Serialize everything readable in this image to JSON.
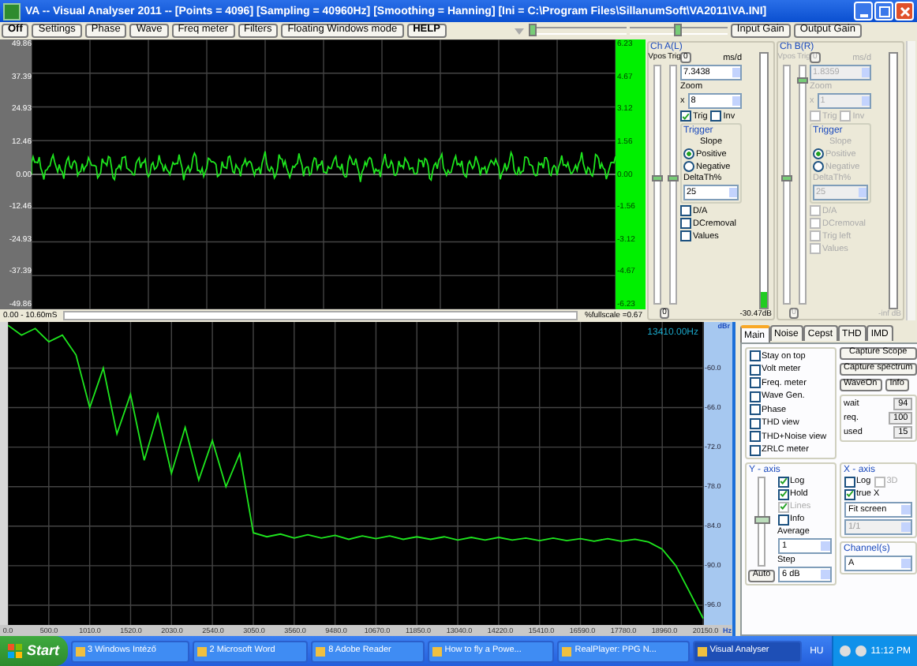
{
  "window": {
    "title": "VA  -- Visual Analyser 2011 --  [Points = 4096]  [Sampling = 40960Hz]  [Smoothing = Hanning]  [Ini = C:\\Program Files\\SillanumSoft\\VA2011\\VA.INI]"
  },
  "toolbar": {
    "buttons": [
      {
        "label": "Off",
        "bold": true
      },
      {
        "label": "Settings",
        "bold": false
      },
      {
        "label": "Phase",
        "bold": false
      },
      {
        "label": "Wave",
        "bold": false
      },
      {
        "label": "Freq meter",
        "bold": false
      },
      {
        "label": "Filters",
        "bold": false
      },
      {
        "label": "Floating Windows mode",
        "bold": false
      },
      {
        "label": "HELP",
        "bold": true
      }
    ],
    "sliders": [
      {
        "level": 0.0
      },
      {
        "level": 0.5
      }
    ],
    "gain_buttons": [
      "Input Gain",
      "Output Gain"
    ]
  },
  "scope": {
    "left_ticks": [
      "49.86",
      "37.39",
      "24.93",
      "12.46",
      "0.00",
      "-12.46",
      "-24.93",
      "-37.39",
      "-49.86"
    ],
    "right_ticks": [
      "6.23",
      "4.67",
      "3.12",
      "1.56",
      "0.00",
      "-1.56",
      "-3.12",
      "-4.67",
      "-6.23"
    ],
    "time_range": "0.00 - 10.60mS",
    "fullscale": "%fullscale =0.67"
  },
  "channels": [
    {
      "title": "Ch A(L)",
      "disabled": false,
      "vpos_label": "Vpos",
      "trig_label": "Trig",
      "sliders": [
        {
          "level": 0.53
        },
        {
          "level": 0.53
        }
      ],
      "zero_button": "0",
      "ms_label": "ms/d",
      "ms_value": "7.3438",
      "zoom_label": "Zoom",
      "zoom_prefix": "x",
      "zoom_value": "8",
      "checks": [
        {
          "label": "Trig",
          "checked": true
        },
        {
          "label": "Inv",
          "checked": false
        }
      ],
      "trigger_title": "Trigger",
      "slope_label": "Slope",
      "slopes": [
        {
          "label": "Positive",
          "selected": true
        },
        {
          "label": "Negative",
          "selected": false
        }
      ],
      "delta_label": "DeltaTh%",
      "delta_value": "25",
      "options": [
        {
          "label": "D/A",
          "checked": false
        },
        {
          "label": "DCremoval",
          "checked": false
        },
        {
          "label": "Values",
          "checked": false
        }
      ],
      "bottom_button": "0",
      "level": 0.06,
      "reading": "-30.47dB"
    },
    {
      "title": "Ch B(R)",
      "disabled": true,
      "vpos_label": "Vpos",
      "trig_label": "Trig",
      "sliders": [
        {
          "level": 0.53
        },
        {
          "level": 0.95
        }
      ],
      "zero_button": "0",
      "ms_label": "ms/d",
      "ms_value": "1.8359",
      "zoom_label": "Zoom",
      "zoom_prefix": "x",
      "zoom_value": "1",
      "checks": [
        {
          "label": "Trig",
          "checked": false
        },
        {
          "label": "Inv",
          "checked": false
        }
      ],
      "trigger_title": "Trigger",
      "slope_label": "Slope",
      "slopes": [
        {
          "label": "Positive",
          "selected": true
        },
        {
          "label": "Negative",
          "selected": false
        }
      ],
      "delta_label": "DeltaTh%",
      "delta_value": "25",
      "options": [
        {
          "label": "D/A",
          "checked": false
        },
        {
          "label": "DCremoval",
          "checked": false
        },
        {
          "label": "Trig left",
          "checked": false
        },
        {
          "label": "Values",
          "checked": false
        }
      ],
      "bottom_button": "0",
      "level": 0.0,
      "reading": "-inf dB"
    }
  ],
  "spectrum": {
    "freq_readout": "13410.00Hz",
    "chart_data": {
      "type": "line",
      "xlabel": "Hz",
      "ylabel": "dBr",
      "ylim": [
        -99,
        -53
      ],
      "grid": true,
      "categories": [
        "0.0",
        null,
        null,
        "500.0",
        null,
        null,
        "1010.0",
        null,
        null,
        "1520.0",
        null,
        null,
        "2030.0",
        null,
        null,
        "2540.0",
        null,
        null,
        "3050.0",
        null,
        null,
        "3560.0",
        null,
        null,
        "9480.0",
        null,
        null,
        "10670.0",
        null,
        null,
        "11850.0",
        null,
        null,
        "13040.0",
        null,
        null,
        "14220.0",
        null,
        null,
        "15410.0",
        null,
        null,
        "16590.0",
        null,
        null,
        "17780.0",
        null,
        null,
        "18960.0",
        null,
        null,
        "20150.0"
      ],
      "series": [
        {
          "name": "A",
          "color": "#1ee61e",
          "values": [
            -53.5,
            -55,
            -54,
            -56,
            -55,
            -58,
            -66,
            -60,
            -70,
            -64,
            -74,
            -67,
            -76,
            -69,
            -77,
            -71,
            -78,
            -73,
            -85,
            -85.6,
            -85.2,
            -85.8,
            -85.3,
            -85.8,
            -85.4,
            -86,
            -85.5,
            -85.9,
            -85.5,
            -86,
            -85.6,
            -86,
            -85.6,
            -86.1,
            -85.7,
            -86.1,
            -85.7,
            -86.1,
            -85.8,
            -86.2,
            -85.8,
            -86.2,
            -85.9,
            -86.3,
            -85.9,
            -86.3,
            -86,
            -86.4,
            -87.5,
            -90,
            -94,
            -98
          ]
        }
      ],
      "yticks": [
        {
          "value": -60,
          "label": "-60.0"
        },
        {
          "value": -66,
          "label": "-66.0"
        },
        {
          "value": -72,
          "label": "-72.0"
        },
        {
          "value": -78,
          "label": "-78.0"
        },
        {
          "value": -84,
          "label": "-84.0"
        },
        {
          "value": -90,
          "label": "-90.0"
        },
        {
          "value": -96,
          "label": "-96.0"
        }
      ]
    }
  },
  "panel": {
    "tabs": [
      {
        "label": "Main",
        "selected": true
      },
      {
        "label": "Noise",
        "selected": false
      },
      {
        "label": "Cepst",
        "selected": false
      },
      {
        "label": "THD",
        "selected": false
      },
      {
        "label": "IMD",
        "selected": false
      }
    ],
    "checks": [
      {
        "label": "Stay on top",
        "checked": false
      },
      {
        "label": "Volt meter",
        "checked": false
      },
      {
        "label": "Freq. meter",
        "checked": false
      },
      {
        "label": "Wave Gen.",
        "checked": false
      },
      {
        "label": "Phase",
        "checked": false
      },
      {
        "label": "THD view",
        "checked": false
      },
      {
        "label": "THD+Noise view",
        "checked": false
      },
      {
        "label": "ZRLC meter",
        "checked": false
      }
    ],
    "capture_buttons": [
      "Capture Scope",
      "Capture spectrum"
    ],
    "small_buttons": [
      "WaveOn",
      "Info"
    ],
    "stats": [
      {
        "label": "wait",
        "value": "94"
      },
      {
        "label": "req.",
        "value": "100"
      },
      {
        "label": "used",
        "value": "15"
      }
    ],
    "y_axis": {
      "title": "Y - axis",
      "checks": [
        {
          "label": "Log",
          "checked": true,
          "disabled": false
        },
        {
          "label": "Hold",
          "checked": true,
          "disabled": false
        },
        {
          "label": "Lines",
          "checked": true,
          "disabled": true
        },
        {
          "label": "Info",
          "checked": false,
          "disabled": false
        }
      ],
      "average_label": "Average",
      "average": "1",
      "step_label": "Step",
      "step": "6 dB",
      "auto_button": "Auto",
      "slider": {
        "level": 0.5
      }
    },
    "x_axis": {
      "title": "X - axis",
      "checks": [
        {
          "label": "Log",
          "checked": false,
          "disabled": false
        },
        {
          "label": "3D",
          "checked": false,
          "disabled": true
        },
        {
          "label": "true X",
          "checked": true,
          "disabled": false
        }
      ],
      "selects": [
        {
          "value": "Fit screen",
          "disabled": false
        },
        {
          "value": "1/1",
          "disabled": true
        }
      ]
    },
    "channels": {
      "title": "Channel(s)"
    }
  },
  "taskbar": {
    "start": "Start",
    "items": [
      {
        "label": "3 Windows Intéző",
        "selected": false
      },
      {
        "label": "2 Microsoft Word",
        "selected": false
      },
      {
        "label": "8 Adobe Reader",
        "selected": false
      },
      {
        "label": "How to fly a Powe...",
        "selected": false
      },
      {
        "label": "RealPlayer: PPG N...",
        "selected": false
      },
      {
        "label": "Visual Analyser",
        "selected": true
      }
    ],
    "language": "HU",
    "clock": "11:12 PM"
  }
}
